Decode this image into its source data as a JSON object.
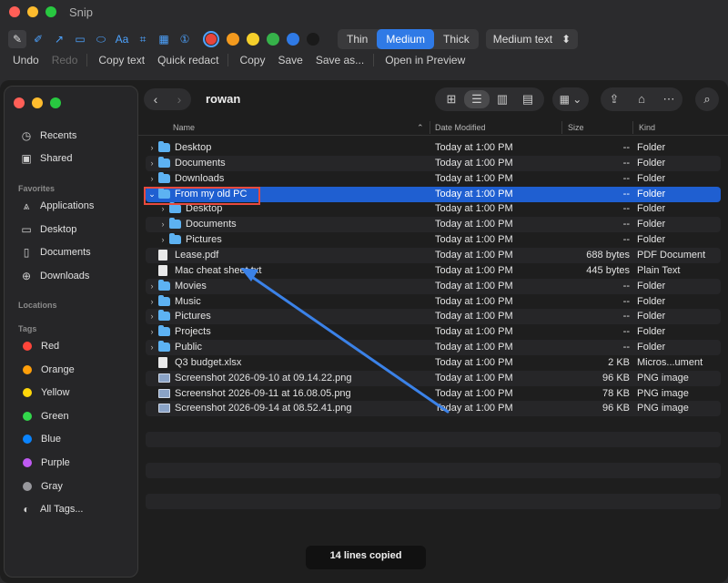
{
  "snip": {
    "title": "Snip",
    "tools": [
      {
        "icon": "pencil-icon",
        "glyph": "✎"
      },
      {
        "icon": "highlighter-icon",
        "glyph": "✐"
      },
      {
        "icon": "arrow-tool-icon",
        "glyph": "↗"
      },
      {
        "icon": "rectangle-tool-icon",
        "glyph": "▭"
      },
      {
        "icon": "ellipse-tool-icon",
        "glyph": "⬭"
      },
      {
        "icon": "text-tool-icon",
        "glyph": "Aa"
      },
      {
        "icon": "crop-tool-icon",
        "glyph": "⌗"
      },
      {
        "icon": "pixelate-tool-icon",
        "glyph": "▦"
      },
      {
        "icon": "step-number-icon",
        "glyph": "①"
      }
    ],
    "colors": [
      "#e8453c",
      "#f39a1e",
      "#f5cf2b",
      "#36b24a",
      "#2f7ae6",
      "#1a1a1a"
    ],
    "selected_color": "#e8453c",
    "stroke_options": [
      "Thin",
      "Medium",
      "Thick"
    ],
    "stroke_selected": "Medium",
    "text_style": "Medium text",
    "actions": {
      "undo": "Undo",
      "redo": "Redo",
      "copy_text": "Copy text",
      "quick_redact": "Quick redact",
      "copy": "Copy",
      "save": "Save",
      "save_as": "Save as...",
      "open_preview": "Open in Preview"
    },
    "toast": "14 lines copied"
  },
  "finder": {
    "folder_title": "rowan",
    "sidebar": {
      "items_top": [
        {
          "label": "Recents",
          "icon": "clock-icon",
          "glyph": "◷"
        },
        {
          "label": "Shared",
          "icon": "shared-folder-icon",
          "glyph": "▣"
        }
      ],
      "favorites_heading": "Favorites",
      "favorites": [
        {
          "label": "Applications",
          "icon": "applications-icon",
          "glyph": "⩓"
        },
        {
          "label": "Desktop",
          "icon": "desktop-icon",
          "glyph": "▭"
        },
        {
          "label": "Documents",
          "icon": "document-icon",
          "glyph": "▯"
        },
        {
          "label": "Downloads",
          "icon": "download-icon",
          "glyph": "⊕"
        }
      ],
      "locations_heading": "Locations",
      "tags_heading": "Tags",
      "tags": [
        {
          "label": "Red",
          "color": "#ff453a"
        },
        {
          "label": "Orange",
          "color": "#ff9f0a"
        },
        {
          "label": "Yellow",
          "color": "#ffd60a"
        },
        {
          "label": "Green",
          "color": "#32d74b"
        },
        {
          "label": "Blue",
          "color": "#0a84ff"
        },
        {
          "label": "Purple",
          "color": "#bf5af2"
        },
        {
          "label": "Gray",
          "color": "#98989d"
        }
      ],
      "all_tags": "All Tags..."
    },
    "columns": {
      "name": "Name",
      "date": "Date Modified",
      "size": "Size",
      "kind": "Kind"
    },
    "rows": [
      {
        "name": "Desktop",
        "date": "Today at 1:00 PM",
        "size": "--",
        "kind": "Folder",
        "type": "folder",
        "indent": 0,
        "expanded": false
      },
      {
        "name": "Documents",
        "date": "Today at 1:00 PM",
        "size": "--",
        "kind": "Folder",
        "type": "folder",
        "indent": 0,
        "expanded": false
      },
      {
        "name": "Downloads",
        "date": "Today at 1:00 PM",
        "size": "--",
        "kind": "Folder",
        "type": "folder",
        "indent": 0,
        "expanded": false
      },
      {
        "name": "From my old PC",
        "date": "Today at 1:00 PM",
        "size": "--",
        "kind": "Folder",
        "type": "folder",
        "indent": 0,
        "expanded": true,
        "selected": true
      },
      {
        "name": "Desktop",
        "date": "Today at 1:00 PM",
        "size": "--",
        "kind": "Folder",
        "type": "folder",
        "indent": 1,
        "expanded": false
      },
      {
        "name": "Documents",
        "date": "Today at 1:00 PM",
        "size": "--",
        "kind": "Folder",
        "type": "folder",
        "indent": 1,
        "expanded": false
      },
      {
        "name": "Pictures",
        "date": "Today at 1:00 PM",
        "size": "--",
        "kind": "Folder",
        "type": "folder",
        "indent": 1,
        "expanded": false
      },
      {
        "name": "Lease.pdf",
        "date": "Today at 1:00 PM",
        "size": "688 bytes",
        "kind": "PDF Document",
        "type": "doc",
        "indent": 0
      },
      {
        "name": "Mac cheat sheet.txt",
        "date": "Today at 1:00 PM",
        "size": "445 bytes",
        "kind": "Plain Text",
        "type": "doc",
        "indent": 0
      },
      {
        "name": "Movies",
        "date": "Today at 1:00 PM",
        "size": "--",
        "kind": "Folder",
        "type": "folder",
        "indent": 0,
        "expanded": false
      },
      {
        "name": "Music",
        "date": "Today at 1:00 PM",
        "size": "--",
        "kind": "Folder",
        "type": "folder",
        "indent": 0,
        "expanded": false
      },
      {
        "name": "Pictures",
        "date": "Today at 1:00 PM",
        "size": "--",
        "kind": "Folder",
        "type": "folder",
        "indent": 0,
        "expanded": false
      },
      {
        "name": "Projects",
        "date": "Today at 1:00 PM",
        "size": "--",
        "kind": "Folder",
        "type": "folder",
        "indent": 0,
        "expanded": false
      },
      {
        "name": "Public",
        "date": "Today at 1:00 PM",
        "size": "--",
        "kind": "Folder",
        "type": "folder",
        "indent": 0,
        "expanded": false
      },
      {
        "name": "Q3 budget.xlsx",
        "date": "Today at 1:00 PM",
        "size": "2 KB",
        "kind": "Micros...ument",
        "type": "doc",
        "indent": 0
      },
      {
        "name": "Screenshot 2026-09-10 at 09.14.22.png",
        "date": "Today at 1:00 PM",
        "size": "96 KB",
        "kind": "PNG image",
        "type": "image",
        "indent": 0
      },
      {
        "name": "Screenshot 2026-09-11 at 16.08.05.png",
        "date": "Today at 1:00 PM",
        "size": "78 KB",
        "kind": "PNG image",
        "type": "image",
        "indent": 0
      },
      {
        "name": "Screenshot 2026-09-14 at 08.52.41.png",
        "date": "Today at 1:00 PM",
        "size": "96 KB",
        "kind": "PNG image",
        "type": "image",
        "indent": 0
      }
    ]
  },
  "annotations": {
    "highlight_color": "#e84a3e",
    "arrow_color": "#3b82e8"
  }
}
